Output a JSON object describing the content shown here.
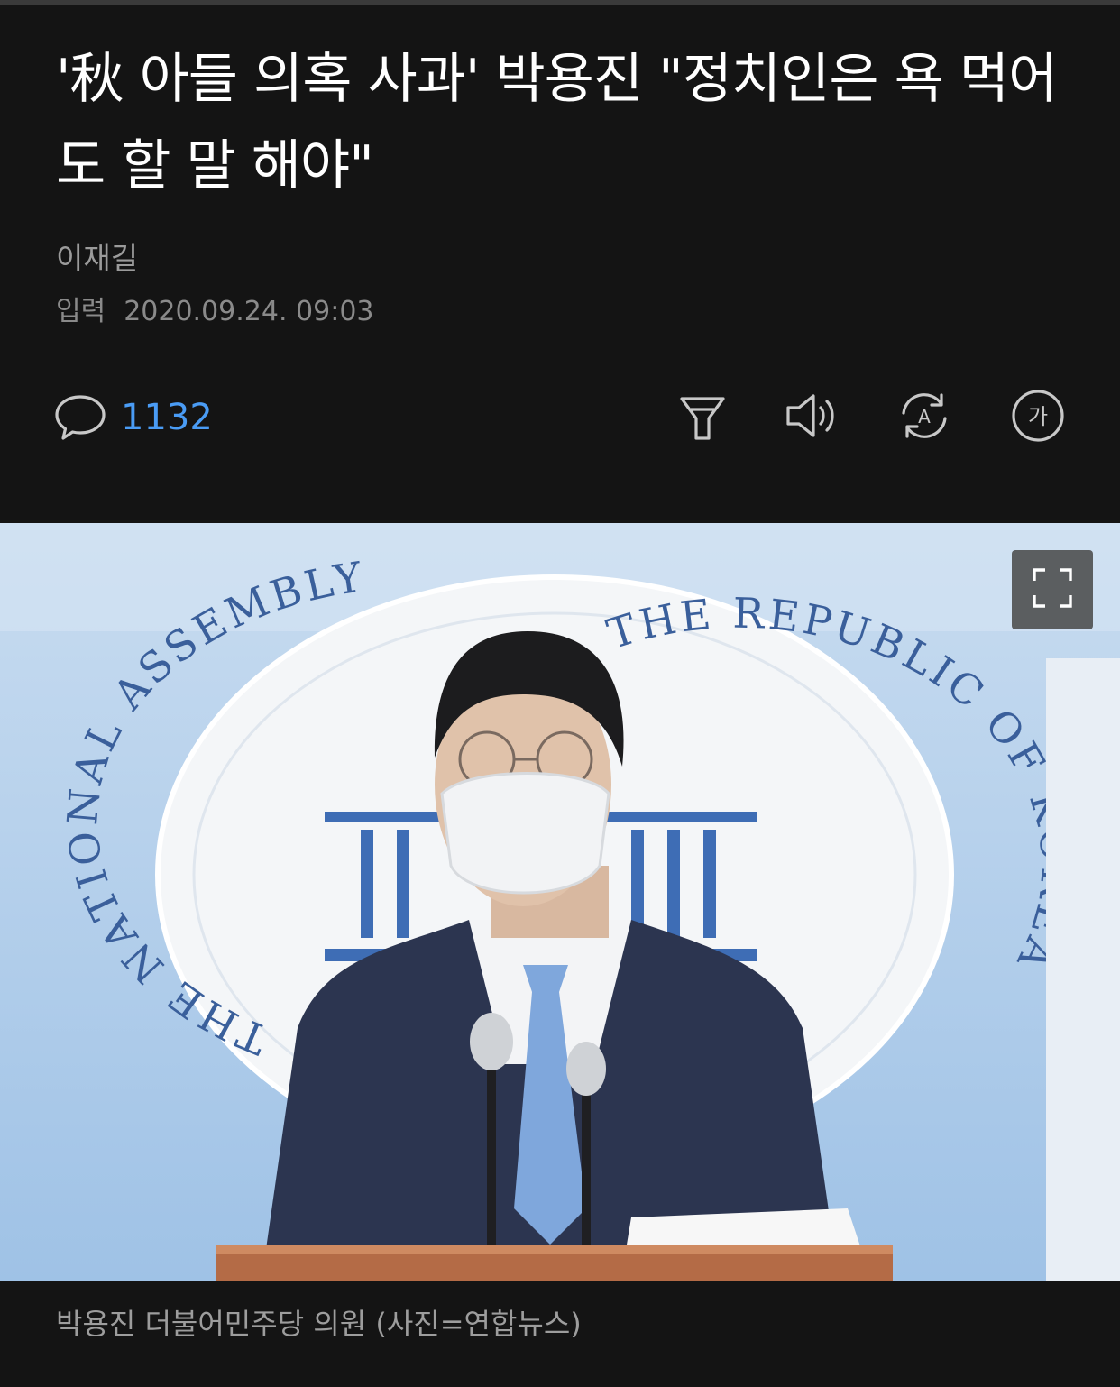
{
  "article": {
    "headline": "'秋 아들 의혹 사과' 박용진 \"정치인은 욕 먹어도 할 말 해야\"",
    "author": "이재길",
    "date_label": "입력",
    "date_value": "2020.09.24. 09:03"
  },
  "toolbar": {
    "comment_count": "1132",
    "accent_color": "#4a9cf5",
    "icons": [
      "comment-icon",
      "summary-icon",
      "speaker-icon",
      "translate-icon",
      "font-size-icon"
    ],
    "font_glyph": "가",
    "translate_glyph": "A"
  },
  "photo": {
    "emblem_text_left": "THE NATIONAL ASSEMBLY",
    "emblem_text_right": "THE REPUBLIC OF KOREA",
    "caption": "박용진 더불어민주당 의원 (사진=연합뉴스)"
  }
}
